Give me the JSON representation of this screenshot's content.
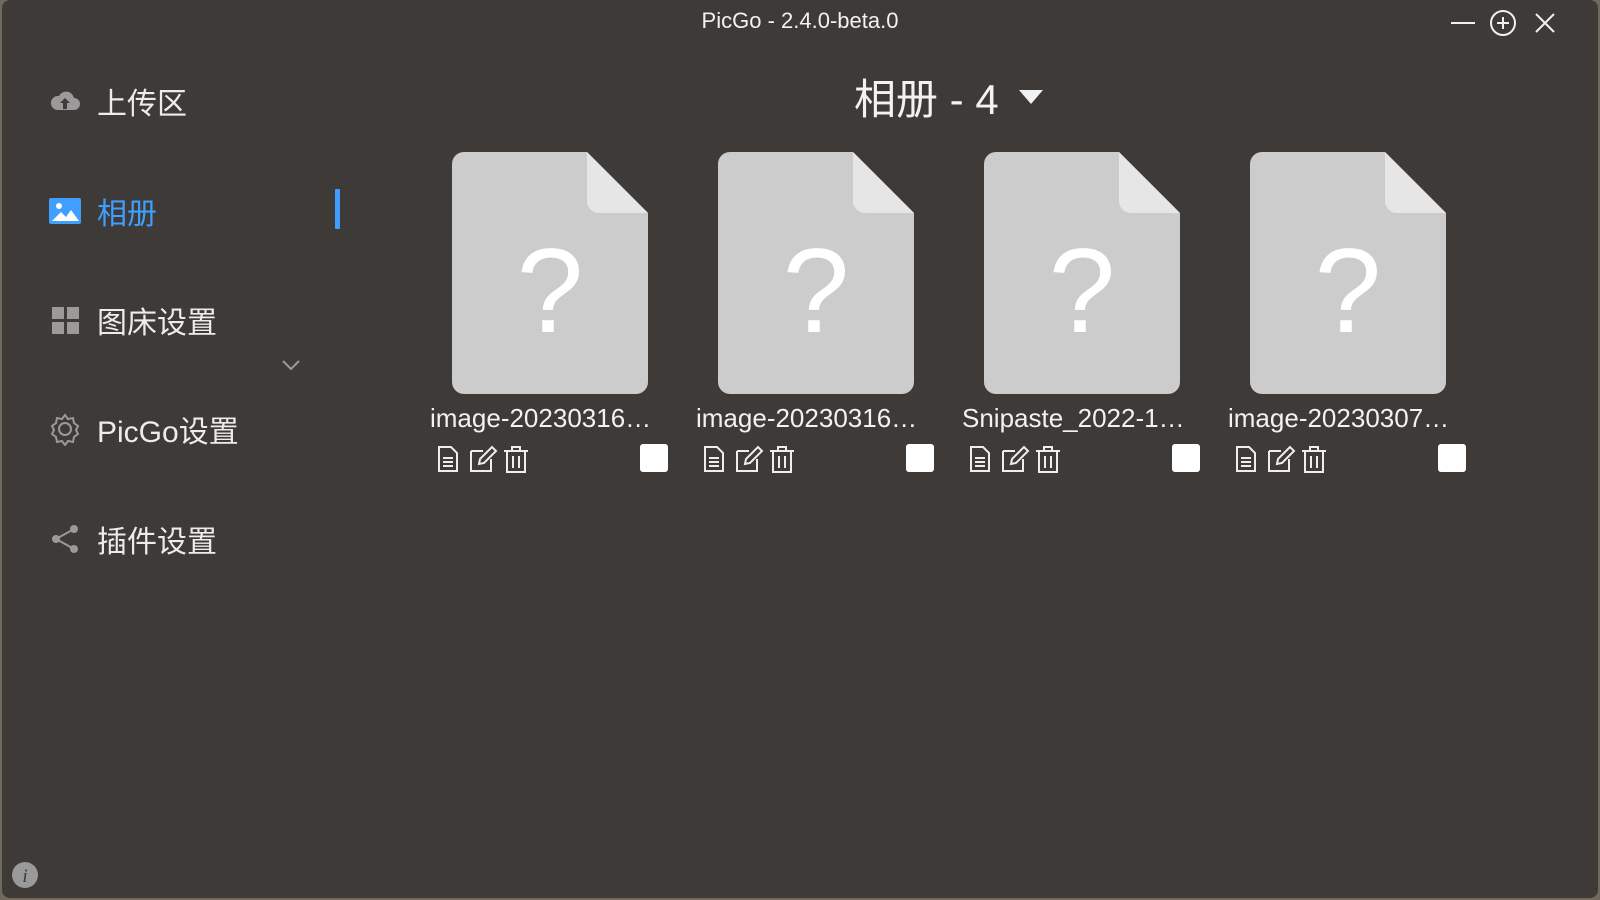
{
  "window": {
    "title": "PicGo - 2.4.0-beta.0",
    "controls": {
      "minimize_icon": "minus-icon",
      "maximize_icon": "plus-circle-icon",
      "close_icon": "close-icon"
    }
  },
  "sidebar": {
    "items": [
      {
        "label": "上传区",
        "icon": "cloud-upload-icon",
        "active": false
      },
      {
        "label": "相册",
        "icon": "image-icon",
        "active": true
      },
      {
        "label": "图床设置",
        "icon": "grid-icon",
        "active": false,
        "expandable": true
      },
      {
        "label": "PicGo设置",
        "icon": "gear-icon",
        "active": false
      },
      {
        "label": "插件设置",
        "icon": "share-icon",
        "active": false
      }
    ],
    "accent_color": "#409eff",
    "info_icon": "info-icon"
  },
  "album": {
    "title": "相册 - 4",
    "items": [
      {
        "filename": "image-20230316…"
      },
      {
        "filename": "image-20230316…"
      },
      {
        "filename": "Snipaste_2022-1…"
      },
      {
        "filename": "image-20230307…"
      }
    ]
  }
}
